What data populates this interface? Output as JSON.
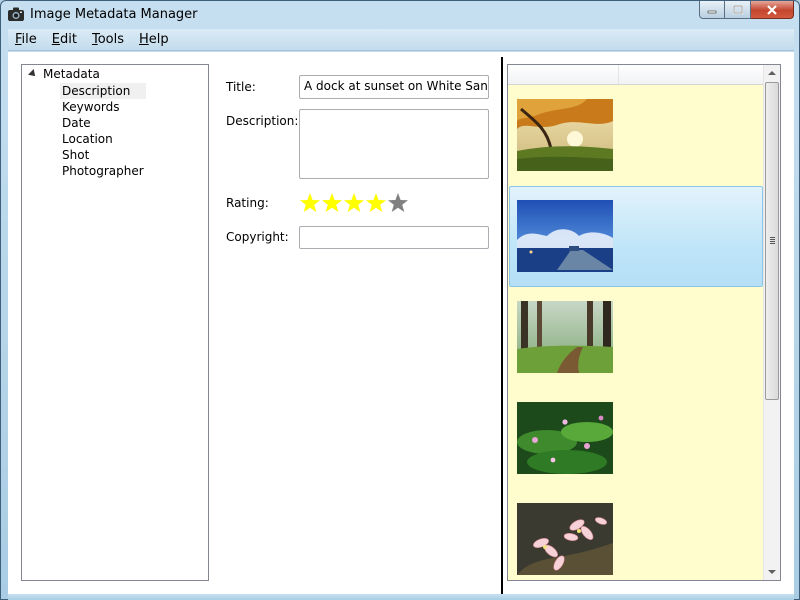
{
  "window": {
    "title": "Image Metadata Manager",
    "icon": "camera-icon"
  },
  "menu": [
    "File",
    "Edit",
    "Tools",
    "Help"
  ],
  "tree": {
    "root": "Metadata",
    "children": [
      "Description",
      "Keywords",
      "Date",
      "Location",
      "Shot",
      "Photographer"
    ],
    "selected": "Description"
  },
  "form": {
    "title_label": "Title:",
    "title_value": "A dock at sunset on White Sands Island",
    "description_label": "Description:",
    "description_value": "",
    "rating_label": "Rating:",
    "rating_value": 4,
    "rating_max": 5,
    "copyright_label": "Copyright:",
    "copyright_value": ""
  },
  "images": [
    {
      "name": "autumn-tree-thumbnail",
      "selected": false
    },
    {
      "name": "dock-sunset-thumbnail",
      "selected": true
    },
    {
      "name": "forest-path-thumbnail",
      "selected": false
    },
    {
      "name": "pink-flowers-green-thumbnail",
      "selected": false
    },
    {
      "name": "plumeria-flowers-thumbnail",
      "selected": false
    }
  ],
  "colors": {
    "list_background": "#fffccd",
    "selection": "#bfe5f8",
    "star_filled": "#ffff00",
    "star_empty": "#808080"
  }
}
